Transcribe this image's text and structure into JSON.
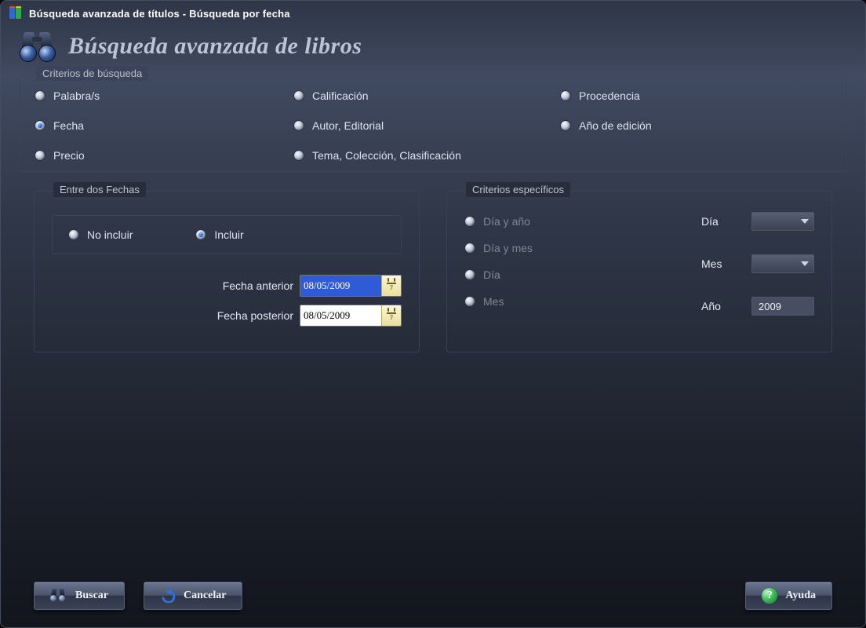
{
  "titlebar": "Búsqueda avanzada de títulos - Búsqueda por fecha",
  "header_title": "Búsqueda avanzada de libros",
  "criteria": {
    "legend": "Criterios de búsqueda",
    "options": {
      "palabras": "Palabra/s",
      "calificacion": "Calificación",
      "procedencia": "Procedencia",
      "fecha": "Fecha",
      "autor": "Autor, Editorial",
      "anio_ed": "Año de edición",
      "precio": "Precio",
      "tema": "Tema, Colección, Clasificación"
    },
    "selected": "fecha"
  },
  "between": {
    "legend": "Entre dos Fechas",
    "no_incluir": "No incluir",
    "incluir": "Incluir",
    "selected": "incluir",
    "fecha_anterior_label": "Fecha anterior",
    "fecha_anterior_value": "08/05/2009",
    "fecha_posterior_label": "Fecha posterior",
    "fecha_posterior_value": "08/05/2009",
    "cal_day": "7"
  },
  "specific": {
    "legend": "Criterios específicos",
    "opts": {
      "dia_anio": "Día y año",
      "dia_mes": "Día y mes",
      "dia": "Día",
      "mes": "Mes"
    },
    "dia_label": "Día",
    "mes_label": "Mes",
    "anio_label": "Año",
    "anio_value": "2009"
  },
  "buttons": {
    "buscar": "Buscar",
    "cancelar": "Cancelar",
    "ayuda": "Ayuda"
  }
}
